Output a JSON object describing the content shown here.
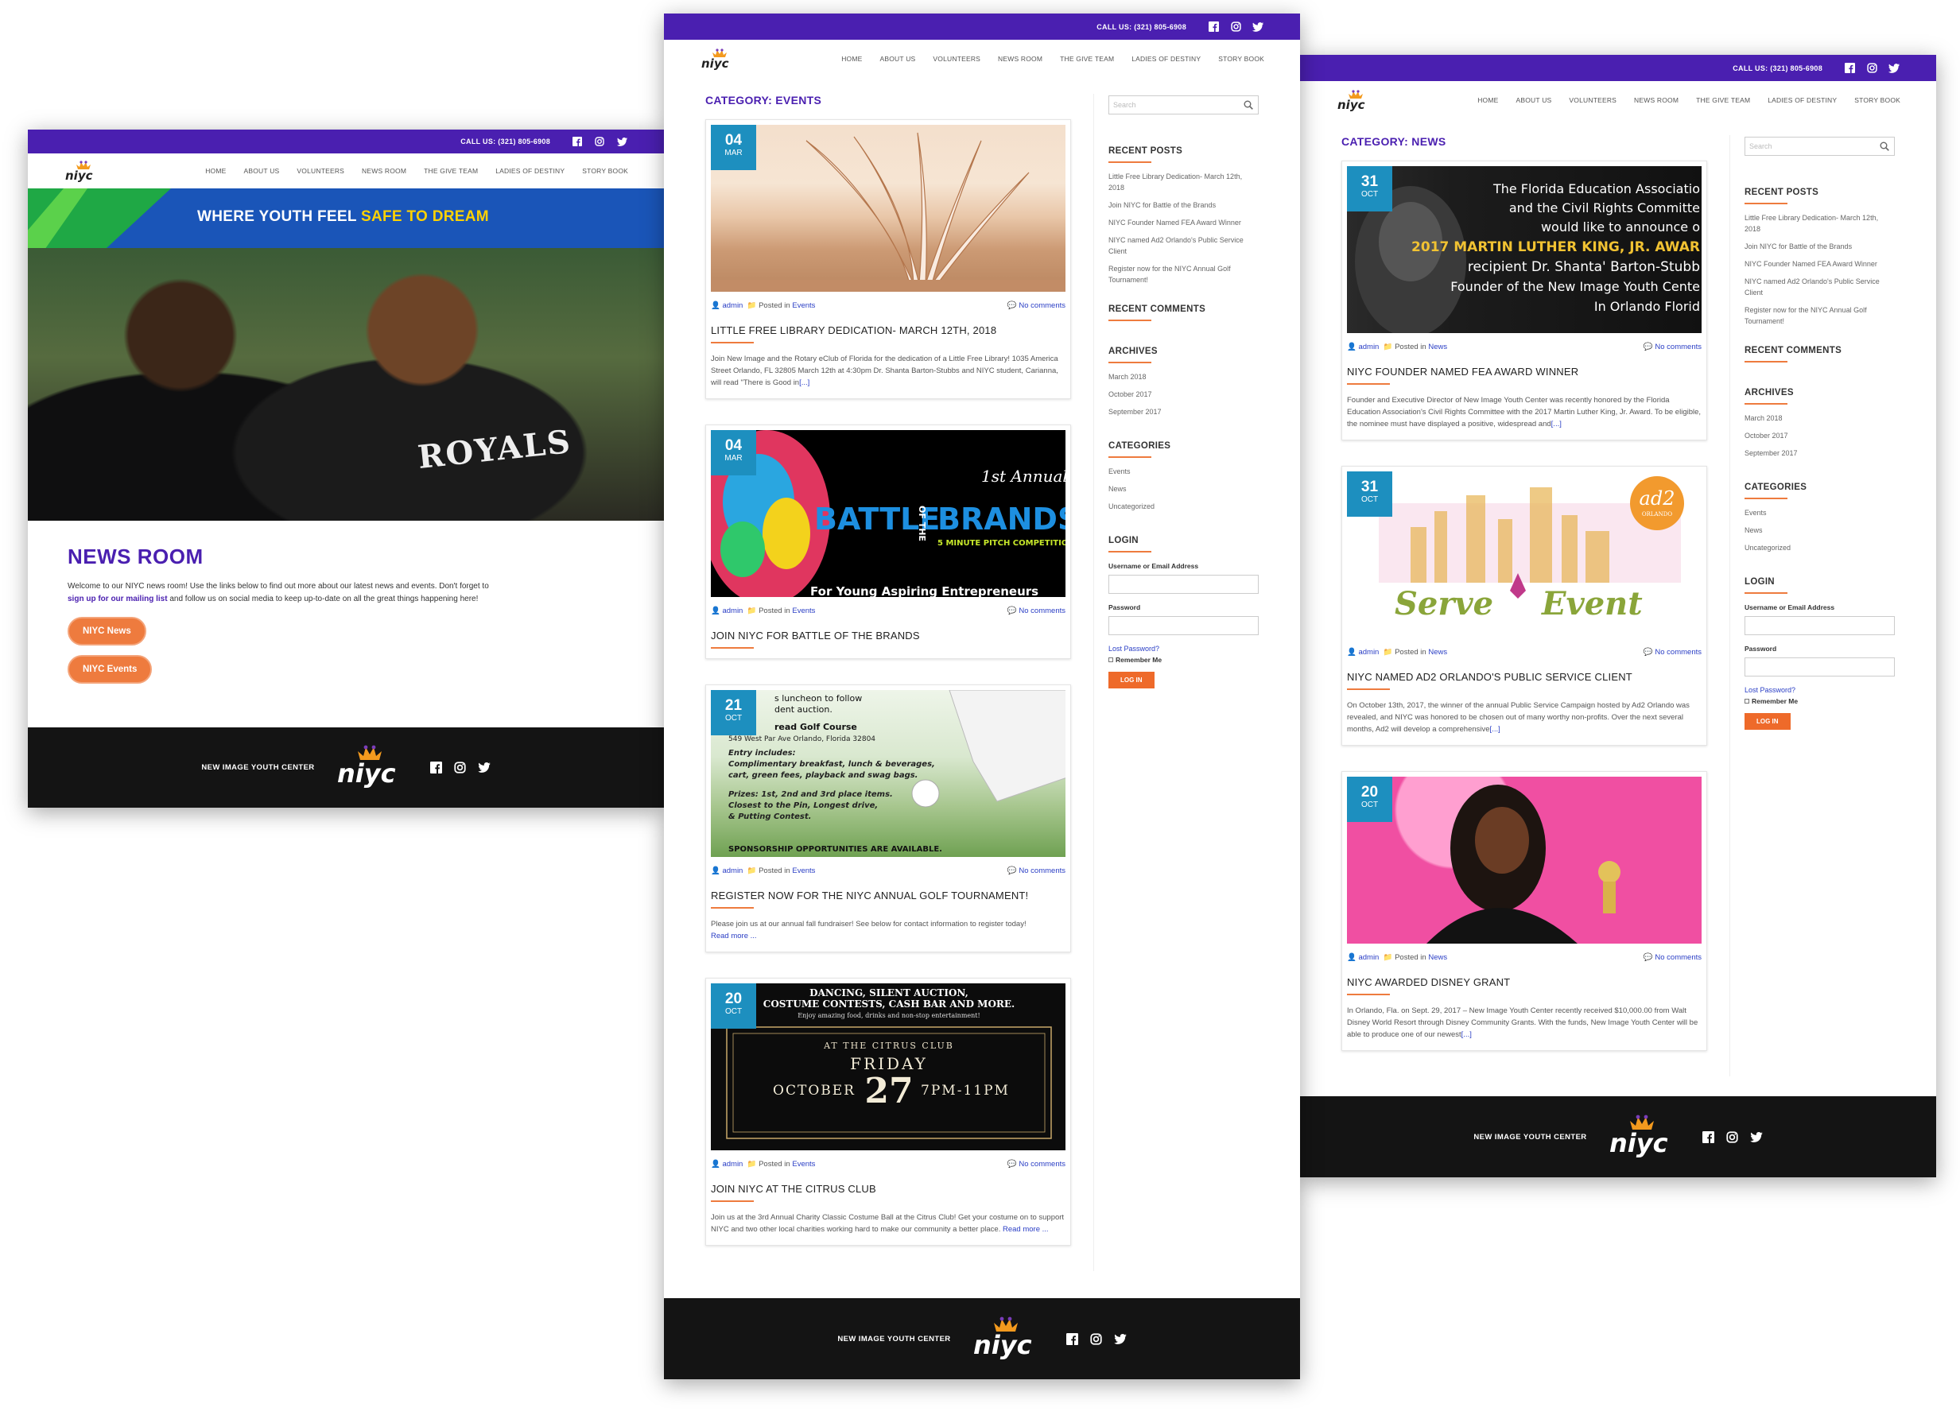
{
  "site": {
    "call": "CALL US: (321) 805-6908",
    "nav": [
      "HOME",
      "ABOUT US",
      "VOLUNTEERS",
      "NEWS ROOM",
      "THE GIVE TEAM",
      "LADIES OF DESTINY",
      "STORY BOOK"
    ],
    "footer_name": "NEW IMAGE YOUTH CENTER",
    "logo_text": "niyc",
    "social_icons": [
      "facebook-icon",
      "instagram-icon",
      "twitter-icon"
    ],
    "brand_color": "#4a1fb0",
    "accent_color": "#ee7b3e"
  },
  "home": {
    "tagline_a": "WHERE YOUTH FEEL ",
    "tagline_b": "SAFE TO DREAM",
    "hero_shirt": "ROYALS",
    "title": "NEWS ROOM",
    "intro_a": "Welcome to our NIYC news room! Use the links below to find out more about our latest news and events. Don't forget to ",
    "intro_link": "sign up for our mailing list",
    "intro_b": " and follow us on social media to keep up-to-date on all the great things happening here!",
    "btn_news": "NIYC News",
    "btn_events": "NIYC Events"
  },
  "events": {
    "heading": "CATEGORY: EVENTS",
    "posts": [
      {
        "day": "04",
        "month": "MAR",
        "author": "admin",
        "posted_in": "Posted in",
        "category": "Events",
        "comments": "No comments",
        "title": "LITTLE FREE LIBRARY DEDICATION- MARCH 12TH, 2018",
        "excerpt": "Join New Image and the Rotary eClub of Florida for the dedication of a Little Free Library! 1035 America Street Orlando, FL 32805 March 12th at 4:30pm Dr. Shanta Barton-Stubbs and NIYC student, Carianna, will read \"There is Good in",
        "more": "[...]"
      },
      {
        "day": "04",
        "month": "MAR",
        "author": "admin",
        "posted_in": "Posted in",
        "category": "Events",
        "comments": "No comments",
        "title": "JOIN NIYC FOR BATTLE OF THE BRANDS",
        "excerpt": "",
        "more": "",
        "img_text_1": "1st Annual",
        "img_text_2": "BATTLE",
        "img_text_3": "OF THE",
        "img_text_4": "BRANDS",
        "img_text_5": "5 MINUTE PITCH COMPETITION",
        "img_text_6": "For Young Aspiring Entrepreneurs"
      },
      {
        "day": "21",
        "month": "OCT",
        "author": "admin",
        "posted_in": "Posted in",
        "category": "Events",
        "comments": "No comments",
        "title": "REGISTER NOW FOR THE NIYC ANNUAL GOLF TOURNAMENT!",
        "excerpt": "Please join us at our annual fall fundraiser! See below for contact information to register today!",
        "more": "Read more ...",
        "img_lines": [
          "s luncheon to follow",
          "dent auction.",
          "read Golf Course",
          "549 West Par Ave Orlando, Florida 32804",
          "Entry includes:",
          "Complimentary breakfast, lunch & beverages,",
          "cart, green fees, playback and swag bags.",
          "Prizes: 1st, 2nd and 3rd place items.",
          "Closest to the Pin, Longest drive,",
          "& Putting Contest.",
          "SPONSORSHIP OPPORTUNITIES ARE AVAILABLE."
        ]
      },
      {
        "day": "20",
        "month": "OCT",
        "author": "admin",
        "posted_in": "Posted in",
        "category": "Events",
        "comments": "No comments",
        "title": "JOIN NIYC AT THE CITRUS CLUB",
        "excerpt": "Join us at the 3rd Annual Charity Classic Costume Ball at the Citrus Club! Get your costume on to support NIYC and two other local charities working hard to make our community a better place.",
        "more": "Read more ...",
        "img_lines": [
          "DANCING, SILENT AUCTION,",
          "COSTUME CONTESTS, CASH BAR AND MORE.",
          "Enjoy amazing food, drinks and non-stop entertainment!",
          "AT THE CITRUS CLUB",
          "FRIDAY",
          "OCTOBER",
          "27",
          "7PM-11PM"
        ]
      }
    ]
  },
  "news": {
    "heading": "CATEGORY: NEWS",
    "posts": [
      {
        "day": "31",
        "month": "OCT",
        "author": "admin",
        "posted_in": "Posted in",
        "category": "News",
        "comments": "No comments",
        "title": "NIYC FOUNDER NAMED FEA AWARD WINNER",
        "excerpt": "Founder and Executive Director of New Image Youth Center was recently honored by the Florida Education Association's Civil Rights Committee with the 2017 Martin Luther King, Jr. Award. To be eligible, the nominee must have displayed a positive, widespread and",
        "more": "[...]",
        "img_lines": [
          "The Florida Education Associatio",
          "and the Civil Rights Committe",
          "would like to announce o",
          "2017 MARTIN LUTHER KING, JR. AWAR",
          "recipient Dr. Shanta' Barton-Stubb",
          "Founder of the New Image Youth Cente",
          "In Orlando Florid"
        ]
      },
      {
        "day": "31",
        "month": "OCT",
        "author": "admin",
        "posted_in": "Posted in",
        "category": "News",
        "comments": "No comments",
        "title": "NIYC NAMED AD2 ORLANDO'S PUBLIC SERVICE CLIENT",
        "excerpt": "On October 13th, 2017, the winner of the annual Public Service Campaign hosted by Ad2 Orlando was revealed, and NIYC was honored to be chosen out of many worthy non-profits. Over the next several months, Ad2 will develop a comprehensive",
        "more": "[...]",
        "img_lines": [
          "Serve",
          "Event",
          "ad2",
          "ORLANDO"
        ]
      },
      {
        "day": "20",
        "month": "OCT",
        "author": "admin",
        "posted_in": "Posted in",
        "category": "News",
        "comments": "No comments",
        "title": "NIYC AWARDED DISNEY GRANT",
        "excerpt": "In Orlando, Fla. on Sept. 29, 2017 – New Image Youth Center recently received $10,000.00 from Walt Disney World Resort through Disney Community Grants. With the funds, New Image Youth Center will be able to produce one of our newest",
        "more": "[...]"
      }
    ]
  },
  "sidebar": {
    "search_placeholder": "Search",
    "recent_posts_title": "RECENT POSTS",
    "recent_posts": [
      "Little Free Library Dedication- March 12th, 2018",
      "Join NIYC for Battle of the Brands",
      "NIYC Founder Named FEA Award Winner",
      "NIYC named Ad2 Orlando's Public Service Client",
      "Register now for the NIYC Annual Golf Tournament!"
    ],
    "recent_comments_title": "RECENT COMMENTS",
    "archives_title": "ARCHIVES",
    "archives": [
      "March 2018",
      "October 2017",
      "September 2017"
    ],
    "categories_title": "CATEGORIES",
    "categories": [
      "Events",
      "News",
      "Uncategorized"
    ],
    "login_title": "LOGIN",
    "user_label": "Username or Email Address",
    "pass_label": "Password",
    "lost": "Lost Password?",
    "remember": "Remember Me",
    "login_btn": "LOG IN"
  }
}
